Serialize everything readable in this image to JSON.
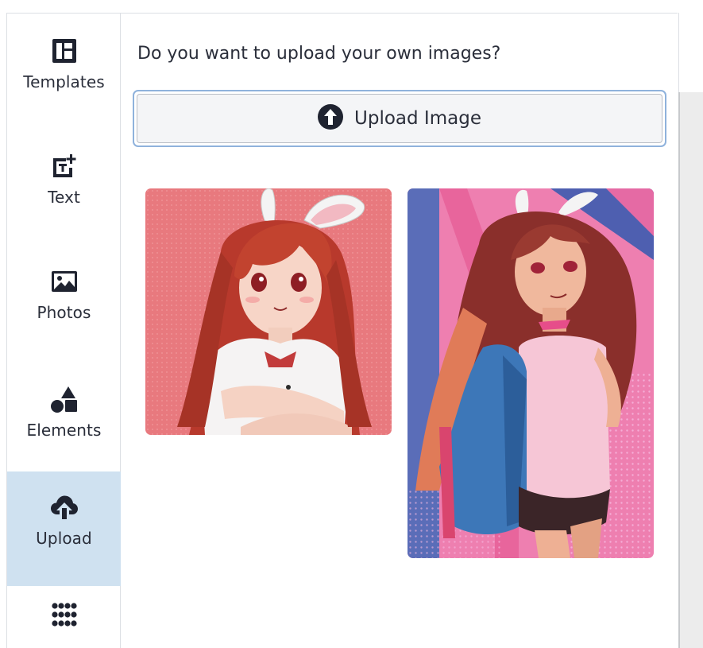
{
  "sidebar": {
    "items": [
      {
        "label": "Templates",
        "icon": "templates-icon"
      },
      {
        "label": "Text",
        "icon": "text-icon"
      },
      {
        "label": "Photos",
        "icon": "photos-icon"
      },
      {
        "label": "Elements",
        "icon": "elements-icon"
      },
      {
        "label": "Upload",
        "icon": "upload-cloud-icon",
        "active": true
      },
      {
        "label": "",
        "icon": "apps-grid-icon"
      }
    ]
  },
  "main": {
    "prompt": "Do you want to upload your own images?",
    "upload_button_label": "Upload Image",
    "uploaded_images": [
      {
        "kind": "anime portrait with bunny ears, pink background"
      },
      {
        "kind": "anime figure with bunny ears and blue jacket, pink/blue background"
      }
    ]
  },
  "colors": {
    "active_bg": "#cfe1f0",
    "focus_ring": "#8fb2dc",
    "icon": "#1f2330"
  }
}
